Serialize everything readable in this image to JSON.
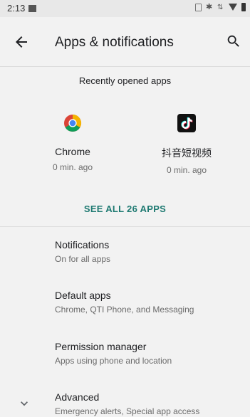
{
  "status_bar": {
    "time": "2:13",
    "icons": [
      "sim-icon",
      "bluetooth-icon",
      "data-icon",
      "wifi-icon",
      "battery-icon"
    ]
  },
  "header": {
    "title": "Apps & notifications",
    "back_icon": "back-arrow-icon",
    "search_icon": "search-icon"
  },
  "recent": {
    "heading": "Recently opened apps",
    "apps": [
      {
        "name": "Chrome",
        "time": "0 min. ago",
        "icon": "chrome-icon"
      },
      {
        "name": "抖音短视频",
        "time": "0 min. ago",
        "icon": "tiktok-icon"
      }
    ],
    "see_all": "SEE ALL 26 APPS"
  },
  "settings": [
    {
      "title": "Notifications",
      "subtitle": "On for all apps"
    },
    {
      "title": "Default apps",
      "subtitle": "Chrome, QTI Phone, and Messaging"
    },
    {
      "title": "Permission manager",
      "subtitle": "Apps using phone and location"
    },
    {
      "title": "Advanced",
      "subtitle": "Emergency alerts, Special app access"
    }
  ],
  "colors": {
    "accent": "#1f7a72",
    "background": "#f2f2f2",
    "status_bar": "#e8e8e8"
  }
}
